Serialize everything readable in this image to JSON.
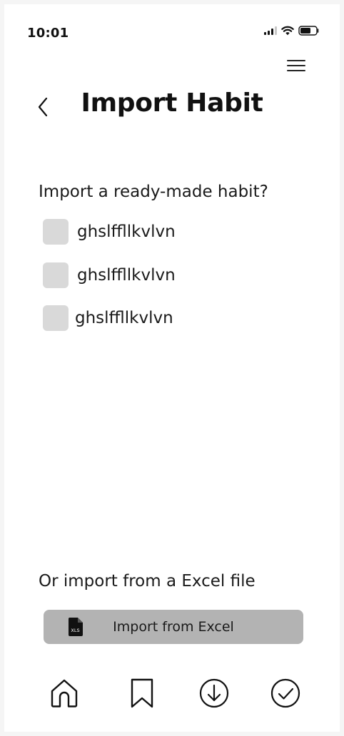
{
  "status_bar": {
    "time": "10:01",
    "icons": [
      "signal-icon",
      "wifi-icon",
      "battery-icon"
    ]
  },
  "header": {
    "title": "Import Habit",
    "back_icon": "chevron-left-icon",
    "menu_icon": "hamburger-menu-icon"
  },
  "habits": {
    "question": "Import a ready-made habit?",
    "options": [
      {
        "label": "ghslffllkvlvn"
      },
      {
        "label": "ghslffllkvlvn"
      },
      {
        "label": "ghslffllkvlvn"
      }
    ]
  },
  "excel": {
    "label": "Or import from a Excel file",
    "button_label": "Import from Excel",
    "file_icon_text": "XLS"
  },
  "bottom_nav": {
    "items": [
      {
        "icon": "home-icon"
      },
      {
        "icon": "bookmark-icon"
      },
      {
        "icon": "download-icon"
      },
      {
        "icon": "check-circle-icon"
      }
    ]
  },
  "colors": {
    "background": "#ffffff",
    "checkbox": "#d9d9d9",
    "button": "#b3b3b3",
    "text": "#1a1a1a"
  }
}
